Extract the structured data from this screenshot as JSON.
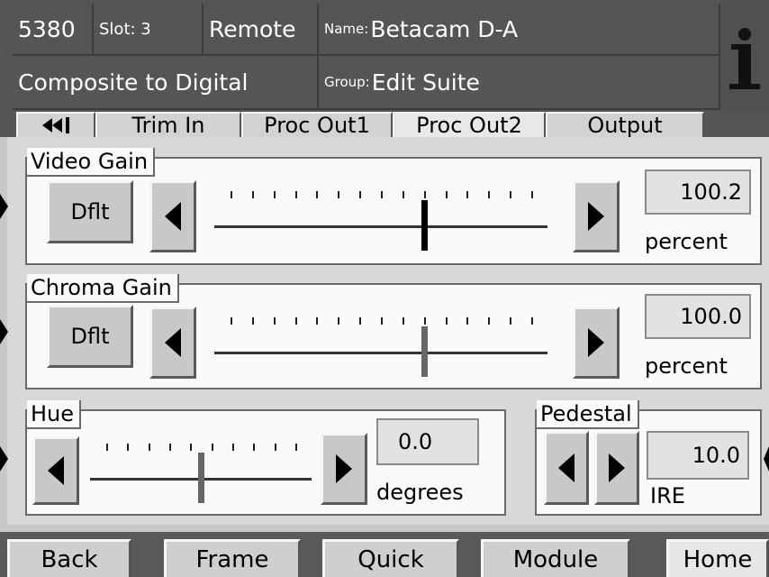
{
  "header": {
    "frame_id": "5380",
    "slot_label": "Slot: 3",
    "mode": "Remote",
    "name_label": "Name:",
    "name_value": "Betacam D-A",
    "module_type": "Composite to Digital",
    "group_label": "Group:",
    "group_value": "Edit Suite",
    "info_icon": "info-icon"
  },
  "tabs": [
    {
      "label": "",
      "icon": "double-left-arrow-icon"
    },
    {
      "label": "Trim In"
    },
    {
      "label": "Proc Out1"
    },
    {
      "label": "Proc Out2",
      "active": true
    },
    {
      "label": "Output"
    }
  ],
  "video_gain": {
    "title": "Video Gain",
    "default_label": "Dflt",
    "value": "100.2",
    "unit": "percent",
    "slider_position": 0.63,
    "thumb_color": "#000000"
  },
  "chroma_gain": {
    "title": "Chroma Gain",
    "default_label": "Dflt",
    "value": "100.0",
    "unit": "percent",
    "slider_position": 0.63,
    "thumb_color": "#666666"
  },
  "hue": {
    "title": "Hue",
    "value": "0.0",
    "unit": "degrees",
    "slider_position": 0.5,
    "thumb_color": "#666666"
  },
  "pedestal": {
    "title": "Pedestal",
    "value": "10.0",
    "unit": "IRE"
  },
  "footer": {
    "back": "Back",
    "frame": "Frame",
    "quick": "Quick",
    "module": "Module",
    "home": "Home"
  }
}
